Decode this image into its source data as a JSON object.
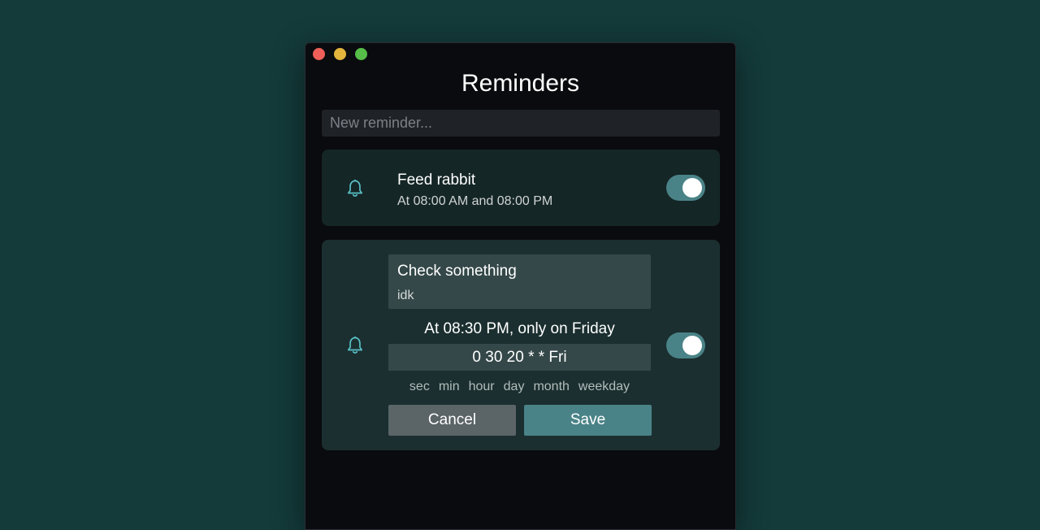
{
  "window": {
    "title": "Reminders"
  },
  "new_reminder": {
    "placeholder": "New reminder..."
  },
  "reminders": [
    {
      "title": "Feed rabbit",
      "subtitle": "At 08:00 AM and 08:00 PM",
      "enabled": true
    },
    {
      "title": "Check something",
      "note": "idk",
      "schedule_text": "At 08:30 PM, only on Friday",
      "cron": "0 30 20 * * Fri",
      "cron_labels": [
        "sec",
        "min",
        "hour",
        "day",
        "month",
        "weekday"
      ],
      "enabled": true,
      "editing": true
    }
  ],
  "buttons": {
    "cancel": "Cancel",
    "save": "Save"
  },
  "colors": {
    "background": "#143a3a",
    "window": "#0a0b0e",
    "accent": "#4a8387",
    "bell": "#59c1c7"
  },
  "icons": {
    "bell": "bell-icon"
  }
}
